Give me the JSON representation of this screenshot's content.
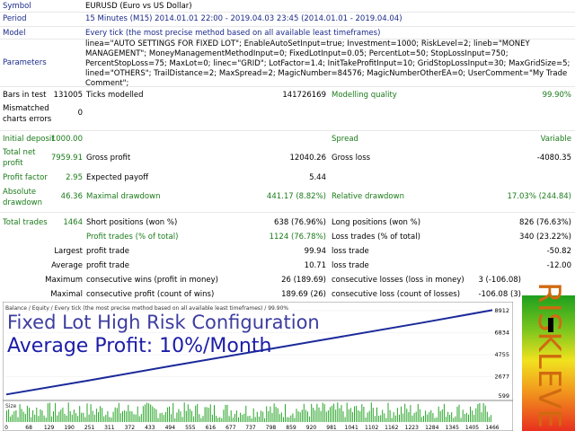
{
  "report": {
    "symbol_label": "Symbol",
    "symbol_value": "EURUSD (Euro vs US Dollar)",
    "period_label": "Period",
    "period_value": "15 Minutes (M15) 2014.01.01 22:00 - 2019.04.03 23:45 (2014.01.01 - 2019.04.04)",
    "model_label": "Model",
    "model_value": "Every tick (the most precise method based on all available least timeframes)",
    "parameters_label": "Parameters",
    "parameters_value": "linea=\"AUTO SETTINGS FOR FIXED LOT\"; EnableAutoSetInput=true; Investment=1000; RiskLevel=2; lineb=\"MONEY MANAGEMENT\"; MoneyManagementMethodInput=0; FixedLotInput=0.05; PercentLot=50; StopLossInput=750; PercentStopLoss=75; MaxLot=0; linec=\"GRID\"; LotFactor=1.4; InitTakeProfitInput=10; GridStopLossInput=30; MaxGridSize=5; lined=\"OTHERS\"; TrailDistance=2; MaxSpread=2; MagicNumber=84576; MagicNumberOtherEA=0; UserComment=\"My Trade Comment\";",
    "bars_label": "Bars in test",
    "bars_value": "131005",
    "ticks_label": "Ticks modelled",
    "ticks_value": "141726169",
    "quality_label": "Modelling quality",
    "quality_value": "99.90%",
    "mismatched_label": "Mismatched charts errors",
    "mismatched_value": "0",
    "deposit_label": "Initial deposit",
    "deposit_value": "1000.00",
    "spread_label": "Spread",
    "spread_value": "Variable",
    "netprofit_label": "Total net profit",
    "netprofit_value": "7959.91",
    "grossprofit_label": "Gross profit",
    "grossprofit_value": "12040.26",
    "grossloss_label": "Gross loss",
    "grossloss_value": "-4080.35",
    "pf_label": "Profit factor",
    "pf_value": "2.95",
    "payoff_label": "Expected payoff",
    "payoff_value": "5.44",
    "absdd_label": "Absolute drawdown",
    "absdd_value": "46.36",
    "maxdd_label": "Maximal drawdown",
    "maxdd_value": "441.17 (8.82%)",
    "reldd_label": "Relative drawdown",
    "reldd_value": "17.03% (244.84)",
    "trades_label": "Total trades",
    "trades_value": "1464",
    "short_label": "Short positions (won %)",
    "short_value": "638 (76.96%)",
    "long_label": "Long positions (won %)",
    "long_value": "826 (76.63%)",
    "profit_trades_label": "Profit trades (% of total)",
    "profit_trades_value": "1124 (76.78%)",
    "loss_trades_label": "Loss trades (% of total)",
    "loss_trades_value": "340 (23.22%)",
    "largest_label": "Largest",
    "largest_pt_label": "profit trade",
    "largest_pt_value": "99.94",
    "largest_lt_label": "loss trade",
    "largest_lt_value": "-50.82",
    "average_label": "Average",
    "average_pt_label": "profit trade",
    "average_pt_value": "10.71",
    "average_lt_label": "loss trade",
    "average_lt_value": "-12.00",
    "maximum_label": "Maximum",
    "max_cw_label": "consecutive wins (profit in money)",
    "max_cw_value": "26 (189.69)",
    "max_cl_label": "consecutive losses (loss in money)",
    "max_cl_value": "3 (-106.08)",
    "maximal_label": "Maximal",
    "mx_cp_label": "consecutive profit (count of wins)",
    "mx_cp_value": "189.69 (26)",
    "mx_cl_label": "consecutive loss (count of losses)",
    "mx_cl_value": "-106.08 (3)"
  },
  "chart_header": "Balance / Equity / Every tick (the most precise method based on all available least timeframes) / 99.90%",
  "size_label": "Size",
  "overlay": {
    "title": "Fixed Lot High Risk Configuration",
    "subtitle": "Average Profit: 10%/Month"
  },
  "risk_text": "RISKLEVEL",
  "colors": {
    "balance": "#1a2a9a",
    "size_bars": "#2aa52a",
    "green_label": "#1a7a1a"
  },
  "chart_data": {
    "type": "line",
    "y_ticks": [
      "8912",
      "6834",
      "4755",
      "2677",
      "599"
    ],
    "x_ticks": [
      "0",
      "68",
      "129",
      "190",
      "251",
      "311",
      "372",
      "433",
      "494",
      "555",
      "616",
      "677",
      "737",
      "798",
      "859",
      "920",
      "981",
      "1041",
      "1102",
      "1162",
      "1223",
      "1284",
      "1345",
      "1405",
      "1466"
    ],
    "ylim": [
      599,
      8912
    ],
    "xlim": [
      0,
      1466
    ],
    "series": [
      {
        "values_x": [
          0,
          250,
          500,
          750,
          1000,
          1250,
          1466
        ],
        "values_y": [
          1000,
          2330,
          3700,
          5050,
          6400,
          7750,
          8960
        ]
      }
    ]
  }
}
